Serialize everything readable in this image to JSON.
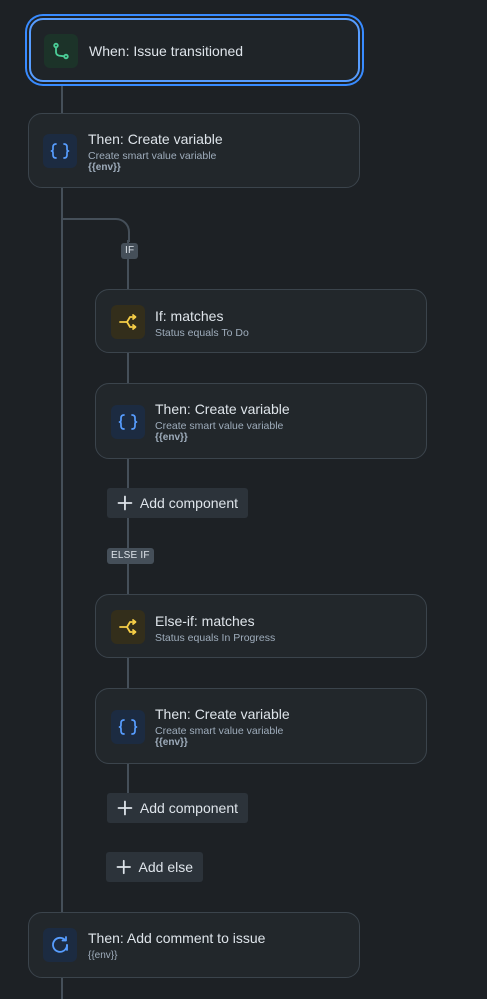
{
  "trigger": {
    "title": "When: Issue transitioned",
    "icon": "branch-icon",
    "color": "#4bce97"
  },
  "action_1": {
    "title": "Then: Create variable",
    "subtitle": "Create smart value variable",
    "value": "{{env}}",
    "icon": "curly-braces-icon"
  },
  "if_branch": {
    "lozenge": "IF",
    "condition": {
      "title": "If: matches",
      "subtitle": "Status equals To Do",
      "icon": "condition-icon",
      "color": "#f5cd47"
    },
    "action": {
      "title": "Then: Create variable",
      "subtitle": "Create smart value variable",
      "value": "{{env}}",
      "icon": "curly-braces-icon"
    },
    "add_component_label": "Add component"
  },
  "else_if_branch": {
    "lozenge": "ELSE IF",
    "condition": {
      "title": "Else-if: matches",
      "subtitle": "Status equals In Progress",
      "icon": "condition-icon",
      "color": "#f5cd47"
    },
    "action": {
      "title": "Then: Create variable",
      "subtitle": "Create smart value variable",
      "value": "{{env}}",
      "icon": "curly-braces-icon"
    },
    "add_component_label": "Add component"
  },
  "add_else_label": "Add else",
  "action_2": {
    "title": "Then: Add comment to issue",
    "value": "{{env}}",
    "icon": "comment-icon"
  },
  "colors": {
    "background": "#1d2125",
    "card": "#22272b",
    "connector": "#454f59",
    "accent": "#388bff",
    "blue_icon": "#579dff"
  }
}
